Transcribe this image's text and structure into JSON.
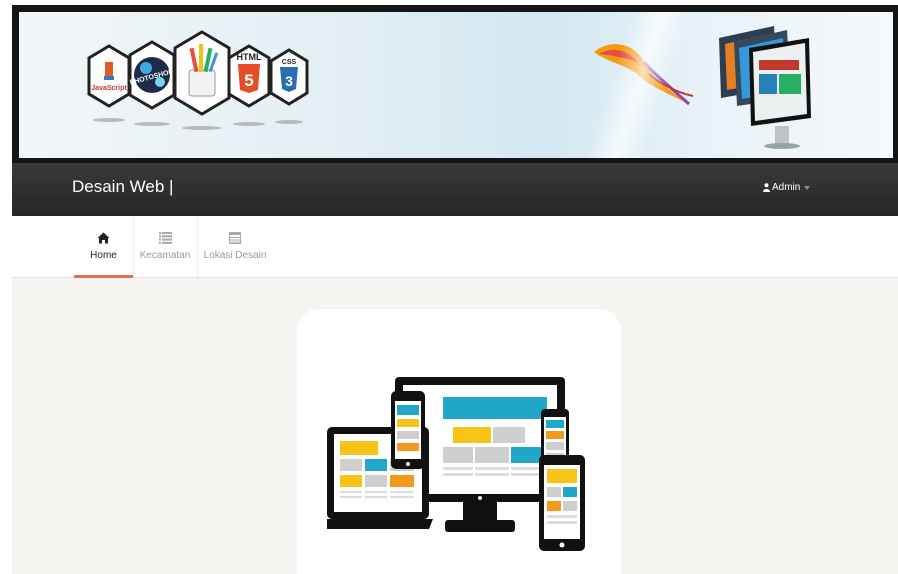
{
  "banner": {
    "logos": [
      "JavaScript",
      "PHOTOSHOP",
      "HTML",
      "CSS"
    ],
    "logo_numbers": [
      "5",
      "3"
    ]
  },
  "navbar": {
    "brand": "Desain Web |",
    "user_label": "Admin"
  },
  "tabs": [
    {
      "label": "Home",
      "icon": "home-icon",
      "active": true
    },
    {
      "label": "Kecamatan",
      "icon": "list-icon",
      "active": false
    },
    {
      "label": "Lokasi Desain",
      "icon": "table-icon",
      "active": false
    }
  ],
  "colors": {
    "navbar": "#2b2b2b",
    "active_tab_underline": "#e0705c",
    "content_bg": "#f6f4f1",
    "accent_cyan": "#1fa8c9",
    "accent_yellow": "#f7c415",
    "accent_orange": "#f39a1c"
  }
}
